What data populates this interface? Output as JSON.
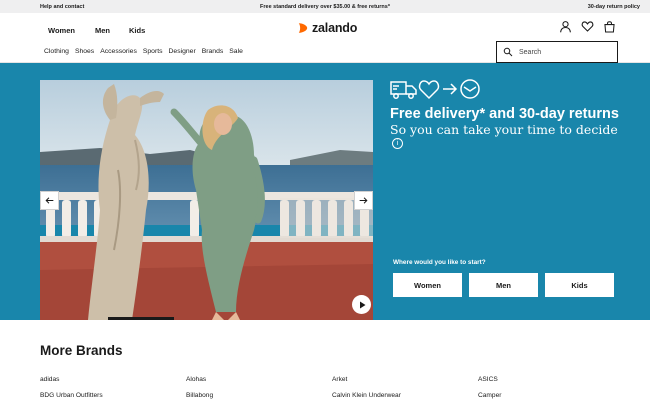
{
  "topbar": {
    "help": "Help and contact",
    "promo": "Free standard delivery over $35.00 & free returns*",
    "returns": "30-day return policy"
  },
  "header": {
    "genders": [
      "Women",
      "Men",
      "Kids"
    ],
    "logo_text": "zalando",
    "logo_color": "#ff6900",
    "icons": [
      "user-icon",
      "heart-icon",
      "bag-icon"
    ],
    "nav": [
      "Clothing",
      "Shoes",
      "Accessories",
      "Sports",
      "Designer",
      "Brands",
      "Sale"
    ],
    "search_placeholder": "Search"
  },
  "hero": {
    "background": "#1986ab",
    "feature_icons": [
      "truck-icon",
      "heart-icon",
      "arrow-right-icon",
      "envelope-icon"
    ],
    "headline": "Free delivery* and 30-day returns",
    "subline": "So you can take your time to decide",
    "info_symbol": "i",
    "start_label": "Where would you like to start?",
    "ctas": [
      "Women",
      "Men",
      "Kids"
    ],
    "carousel_progress": 0.2
  },
  "brands": {
    "title": "More Brands",
    "columns": [
      [
        "adidas",
        "BDG Urban Outfitters"
      ],
      [
        "Alohas",
        "Billabong"
      ],
      [
        "Arket",
        "Calvin Klein Underwear"
      ],
      [
        "ASICS",
        "Camper"
      ]
    ]
  }
}
